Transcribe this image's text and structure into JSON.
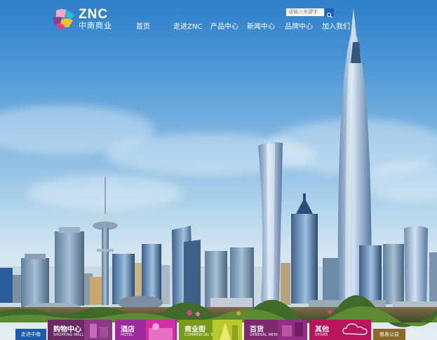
{
  "brand": {
    "logo_text": "ZNC",
    "logo_subtitle": "中南商业"
  },
  "search": {
    "placeholder": "请输入关键字",
    "icon": "search-icon"
  },
  "nav": {
    "items": [
      {
        "label": "首页"
      },
      {
        "label": "走进ZNC"
      },
      {
        "label": "产品中心"
      },
      {
        "label": "新闻中心"
      },
      {
        "label": "品牌中心"
      },
      {
        "label": "加入我们"
      }
    ]
  },
  "bottom_bar": {
    "left_badge": "走进中南",
    "right_badge": "慈善公益",
    "categories": [
      {
        "title": "购物中心",
        "subtitle": "SHOPPING MALL",
        "color": "#6b2a63"
      },
      {
        "title": "酒店",
        "subtitle": "HOTEL",
        "color": "#9c2a9b"
      },
      {
        "title": "商业街",
        "subtitle": "COMMERCIAL STREET",
        "color": "#7a9a1a"
      },
      {
        "title": "百货",
        "subtitle": "GENERAL MERCHANDISE",
        "color": "#7b2a6e"
      },
      {
        "title": "其他",
        "subtitle": "OTHER",
        "color": "#b8155a"
      }
    ]
  },
  "colors": {
    "sky_top": "#2f7ec8",
    "left_badge": "#1d5aa8",
    "right_badge": "#8a6a2a"
  }
}
